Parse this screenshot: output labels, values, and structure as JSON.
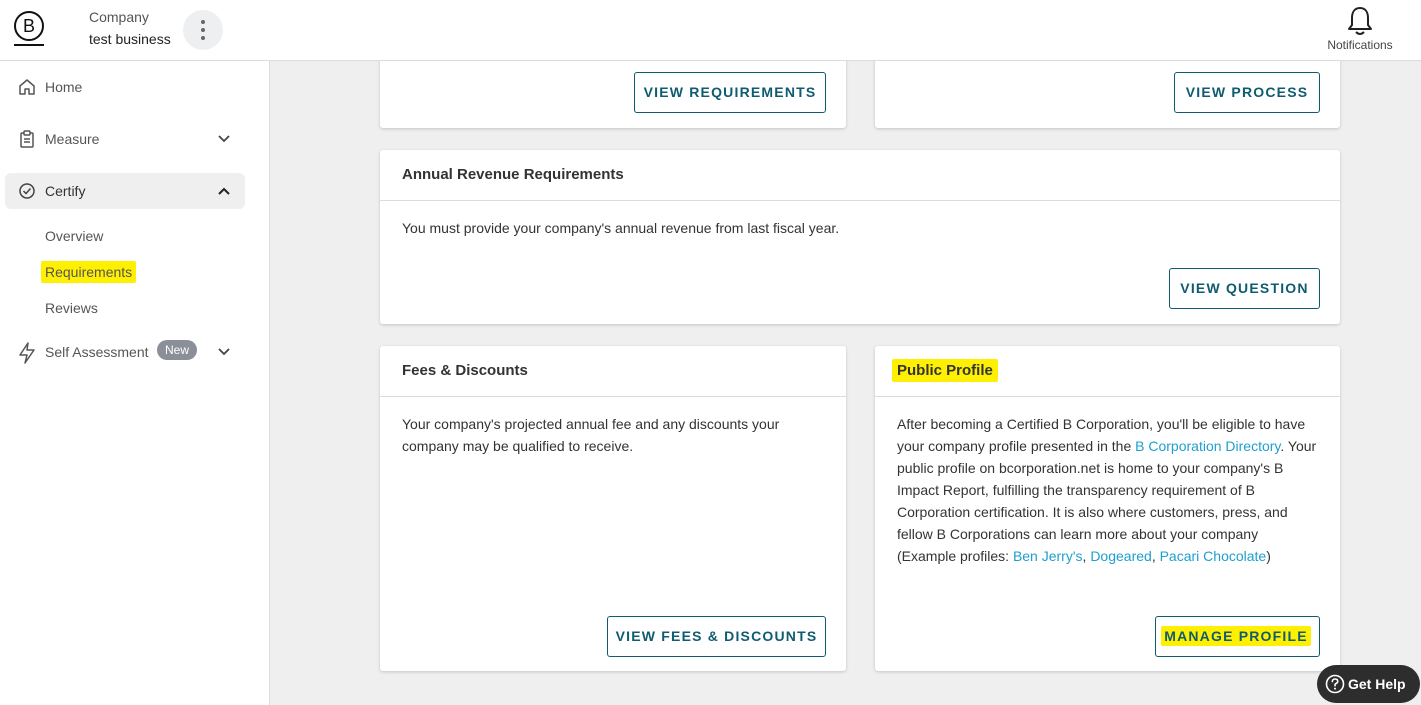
{
  "header": {
    "logo_letter": "B",
    "company_label": "Company",
    "company_name": "test business",
    "notifications_label": "Notifications"
  },
  "sidebar": {
    "home": "Home",
    "measure": "Measure",
    "certify": "Certify",
    "certify_sub": [
      "Overview",
      "Requirements",
      "Reviews"
    ],
    "self_assessment": "Self Assessment",
    "self_assessment_badge": "New"
  },
  "cards": {
    "top_left_button": "VIEW REQUIREMENTS",
    "top_right_button": "VIEW PROCESS",
    "revenue": {
      "title": "Annual Revenue Requirements",
      "body": "You must provide your company's annual revenue from last fiscal year.",
      "button": "VIEW QUESTION"
    },
    "fees": {
      "title": "Fees & Discounts",
      "body": "Your company's projected annual fee and any discounts your company may be qualified to receive.",
      "button": "VIEW FEES & DISCOUNTS"
    },
    "profile": {
      "title": "Public Profile",
      "body_1": "After becoming a Certified B Corporation, you'll be eligible to have your company profile presented in the ",
      "link_directory": "B Corporation Directory",
      "body_2": ". Your public profile on bcorporation.net is home to your company's B Impact Report, fulfilling the transparency requirement of B Corporation certification. It is also where customers, press, and fellow B Corporations can learn more about your company (Example profiles: ",
      "link_ben": "Ben Jerry's",
      "sep": ", ",
      "link_dogeared": "Dogeared",
      "sep2": ", ",
      "link_pacari": "Pacari Chocolate",
      "body_3": ")",
      "button": "MANAGE PROFILE"
    }
  },
  "help": {
    "label": "Get Help"
  },
  "colors": {
    "accent": "#0f5c70",
    "link": "#1f9fcf",
    "highlight": "#ffef00",
    "background": "#efefef"
  }
}
